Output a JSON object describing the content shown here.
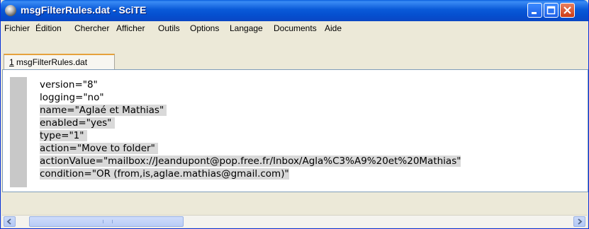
{
  "window": {
    "title": "msgFilterRules.dat - SciTE"
  },
  "menu": {
    "items": [
      "Fichier",
      "Édition",
      "Chercher",
      "Afficher",
      "Outils",
      "Options",
      "Langage",
      "Documents",
      "Aide"
    ]
  },
  "tabs": [
    {
      "number": "1",
      "label": " msgFilterRules.dat"
    }
  ],
  "editor": {
    "lines": [
      "version=\"8\"",
      "logging=\"no\"",
      "name=\"Aglaé et Mathias\" ",
      "enabled=\"yes\" ",
      "type=\"1\" ",
      "action=\"Move to folder\" ",
      "actionValue=\"mailbox://Jeandupont@pop.free.fr/Inbox/Agla%C3%A9%20et%20Mathias\"",
      "condition=\"OR (from,is,aglae.mathias@gmail.com)\""
    ]
  },
  "icons": {
    "app": "scite-icon",
    "minimize": "minimize-icon",
    "maximize": "maximize-icon",
    "close": "close-icon",
    "scroll_left": "arrow-left-icon",
    "scroll_right": "arrow-right-icon"
  },
  "colors": {
    "titlebar": "#0a5ad8",
    "close_button": "#cc3a14",
    "selection": "#d9d9d9",
    "tab_accent": "#e6a23c"
  }
}
